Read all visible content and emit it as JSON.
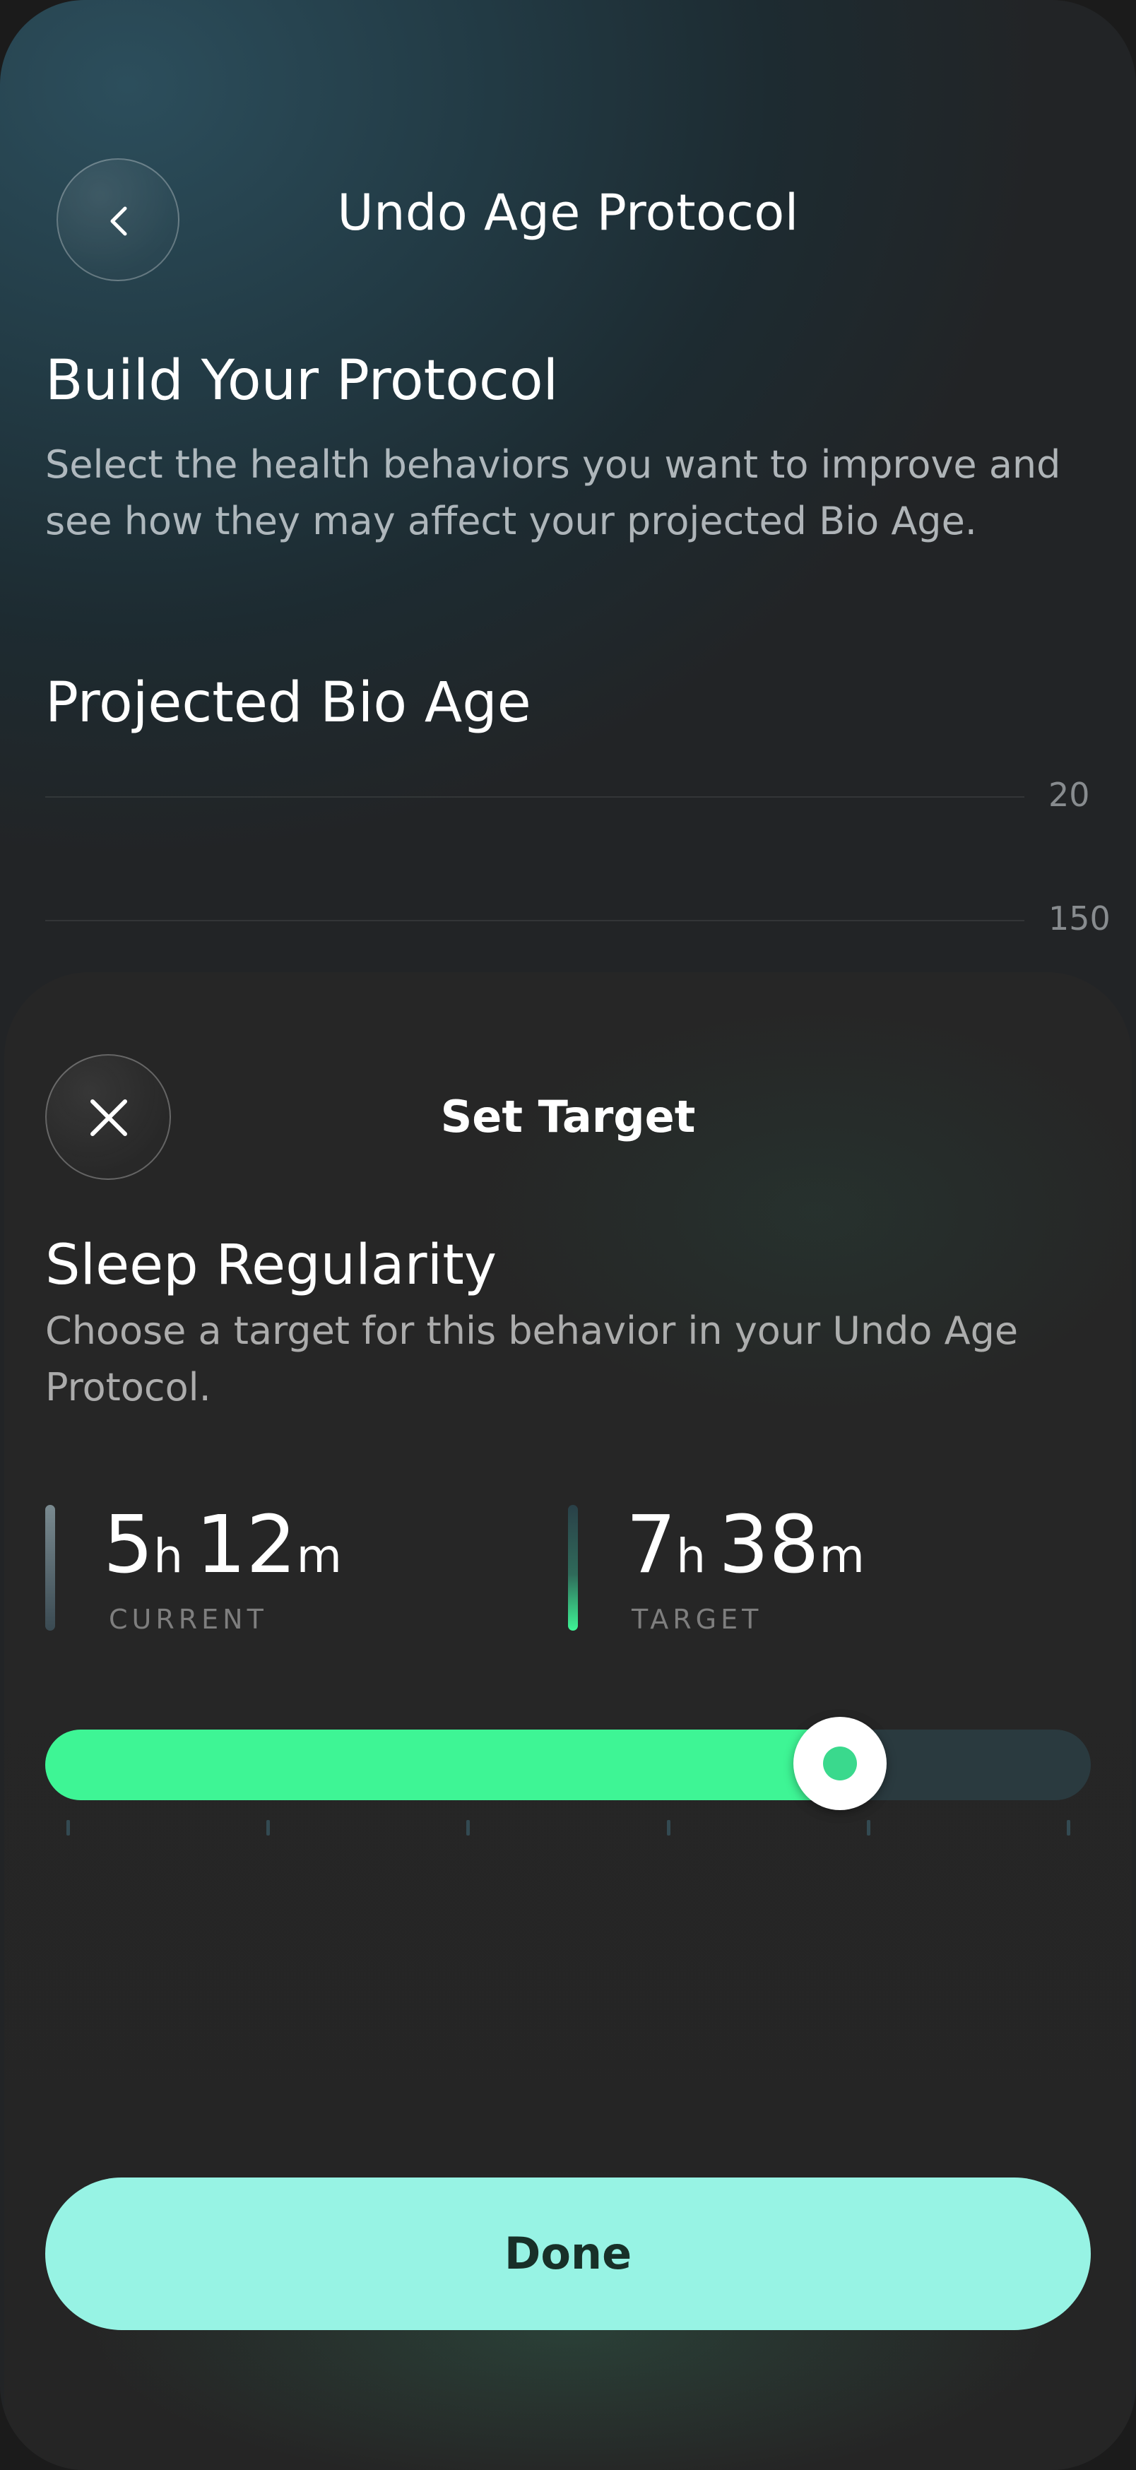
{
  "header": {
    "title": "Undo Age Protocol",
    "back_icon": "chevron-left-icon"
  },
  "intro": {
    "heading": "Build Your Protocol",
    "description": "Select the health behaviors you want to improve and see how they may affect your projected Bio Age."
  },
  "projection": {
    "heading": "Projected Bio Age",
    "tick_labels": [
      "20",
      "150"
    ]
  },
  "sheet": {
    "title": "Set Target",
    "close_icon": "close-icon",
    "behavior_title": "Sleep Regularity",
    "behavior_description": "Choose a target for this behavior in your Undo Age Protocol.",
    "current": {
      "hours": "5",
      "hours_unit": "h",
      "minutes": "12",
      "minutes_unit": "m",
      "label": "CURRENT"
    },
    "target": {
      "hours": "7",
      "hours_unit": "h",
      "minutes": "38",
      "minutes_unit": "m",
      "label": "TARGET"
    },
    "slider": {
      "fill_fraction": 0.76,
      "tick_count": 6
    },
    "done_label": "Done"
  },
  "colors": {
    "accent": "#3ef595",
    "done_button": "#97f3e4",
    "track": "#2a3a3f"
  }
}
